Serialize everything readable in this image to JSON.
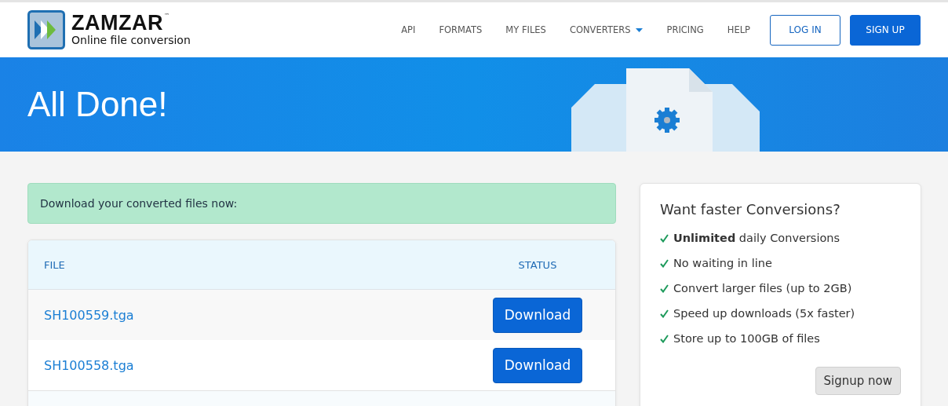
{
  "logo": {
    "name": "ZAMZAR",
    "trademark": "™",
    "tagline": "Online file conversion"
  },
  "nav": [
    {
      "label": "API",
      "has_menu": false
    },
    {
      "label": "FORMATS",
      "has_menu": false
    },
    {
      "label": "MY FILES",
      "has_menu": false
    },
    {
      "label": "CONVERTERS",
      "has_menu": true
    },
    {
      "label": "PRICING",
      "has_menu": false
    },
    {
      "label": "HELP",
      "has_menu": false
    }
  ],
  "auth_buttons": [
    {
      "label": "LOG IN",
      "kind": "outline"
    },
    {
      "label": "SIGN UP",
      "kind": "solid"
    }
  ],
  "banner": {
    "title": "All Done!"
  },
  "alert": "Download your converted files now:",
  "table": {
    "columns": [
      "FILE",
      "STATUS"
    ],
    "rows": [
      {
        "file": "SH100559.tga",
        "action": "Download"
      },
      {
        "file": "SH100558.tga",
        "action": "Download"
      }
    ]
  },
  "promo": {
    "title": "Want faster Conversions?",
    "features": [
      "**Unlimited** daily Conversions",
      "No waiting in line",
      "Convert larger files (up to 2GB)",
      "Speed up downloads (5x faster)",
      "Store up to 100GB of files"
    ],
    "button": "Signup now"
  }
}
